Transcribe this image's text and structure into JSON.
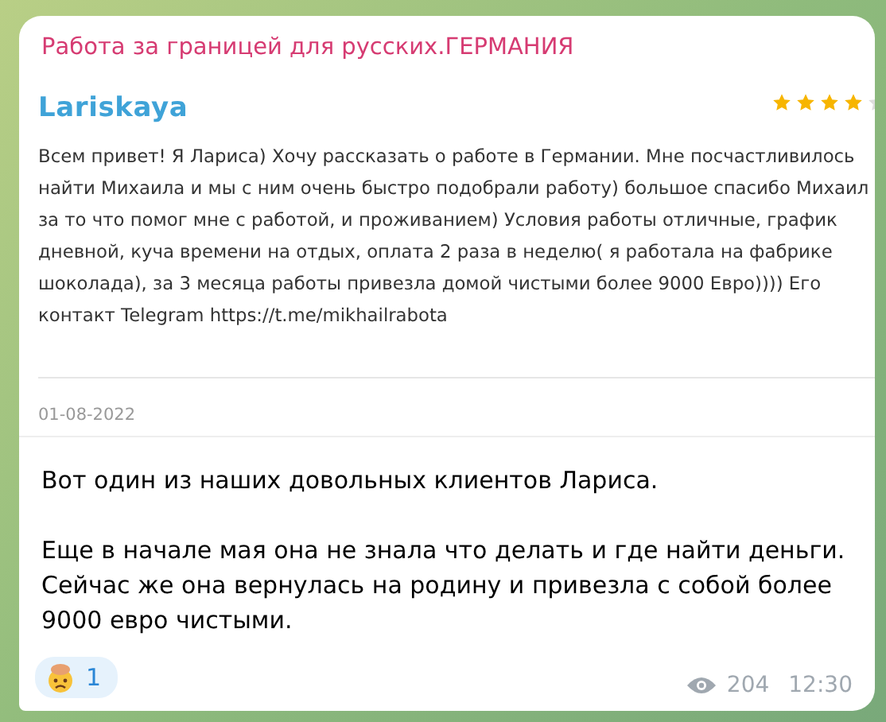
{
  "channel_name": "Работа за границей для русских.ГЕРМАНИЯ",
  "review": {
    "author": "Lariskaya",
    "stars": 4,
    "text": "Всем привет! Я Лариса) Хочу рассказать о работе в Германии. Мне посчастливилось найти Михаила и мы с ним очень быстро подобрали работу) большое спасибо Михаил за то что помог мне с работой, и проживанием) Условия работы отличные, график дневной, куча времени на отдых, оплата 2 раза в неделю( я работала на фабрике шоколада), за 3 месяца работы привезла домой чистыми более 9000 Евро)))) Его контакт Telegram https://t.me/mikhailrabota",
    "date": "01-08-2022"
  },
  "message": [
    "Вот один из наших довольных клиентов Лариса.",
    "Еще в начале мая она не знала что делать и где найти деньги. Сейчас же она вернулась на родину и привезла с собой более 9000 евро чистыми."
  ],
  "reaction": {
    "count": "1"
  },
  "views": "204",
  "time": "12:30"
}
